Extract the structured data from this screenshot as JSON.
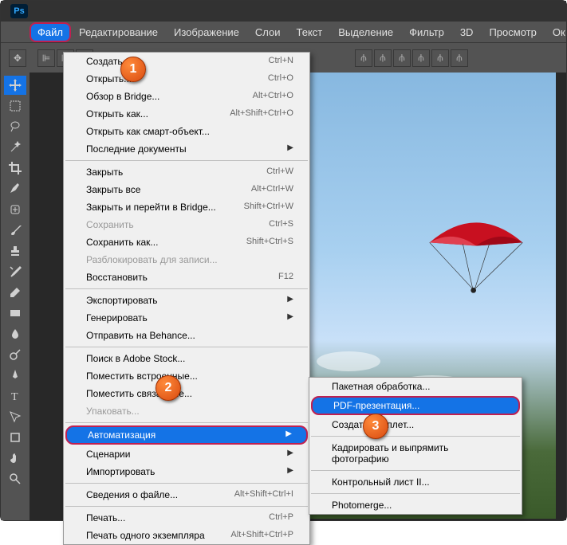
{
  "logo": "Ps",
  "menubar": [
    "Файл",
    "Редактирование",
    "Изображение",
    "Слои",
    "Текст",
    "Выделение",
    "Фильтр",
    "3D",
    "Просмотр",
    "Ок"
  ],
  "file_menu": {
    "groups": [
      [
        {
          "label": "Создать...",
          "shortcut": "Ctrl+N"
        },
        {
          "label": "Открыть...",
          "shortcut": "Ctrl+O"
        },
        {
          "label": "Обзор в Bridge...",
          "shortcut": "Alt+Ctrl+O"
        },
        {
          "label": "Открыть как...",
          "shortcut": "Alt+Shift+Ctrl+O"
        },
        {
          "label": "Открыть как смарт-объект..."
        },
        {
          "label": "Последние документы",
          "arrow": true
        }
      ],
      [
        {
          "label": "Закрыть",
          "shortcut": "Ctrl+W"
        },
        {
          "label": "Закрыть все",
          "shortcut": "Alt+Ctrl+W"
        },
        {
          "label": "Закрыть и перейти в Bridge...",
          "shortcut": "Shift+Ctrl+W"
        },
        {
          "label": "Сохранить",
          "shortcut": "Ctrl+S",
          "disabled": true
        },
        {
          "label": "Сохранить как...",
          "shortcut": "Shift+Ctrl+S"
        },
        {
          "label": "Разблокировать для записи...",
          "disabled": true
        },
        {
          "label": "Восстановить",
          "shortcut": "F12"
        }
      ],
      [
        {
          "label": "Экспортировать",
          "arrow": true
        },
        {
          "label": "Генерировать",
          "arrow": true
        },
        {
          "label": "Отправить на Behance..."
        }
      ],
      [
        {
          "label": "Поиск в Adobe Stock..."
        },
        {
          "label": "Поместить встроенные..."
        },
        {
          "label": "Поместить связанные..."
        },
        {
          "label": "Упаковать...",
          "disabled": true
        }
      ],
      [
        {
          "label": "Автоматизация",
          "arrow": true,
          "highlighted": true
        },
        {
          "label": "Сценарии",
          "arrow": true
        },
        {
          "label": "Импортировать",
          "arrow": true
        }
      ],
      [
        {
          "label": "Сведения о файле...",
          "shortcut": "Alt+Shift+Ctrl+I"
        }
      ],
      [
        {
          "label": "Печать...",
          "shortcut": "Ctrl+P"
        },
        {
          "label": "Печать одного экземпляра",
          "shortcut": "Alt+Shift+Ctrl+P"
        }
      ]
    ]
  },
  "submenu": {
    "groups": [
      [
        {
          "label": "Пакетная обработка..."
        },
        {
          "label": "PDF-презентация...",
          "highlighted": true
        },
        {
          "label": "Создать дроплет..."
        }
      ],
      [
        {
          "label": "Кадрировать и выпрямить фотографию"
        }
      ],
      [
        {
          "label": "Контрольный лист II..."
        }
      ],
      [
        {
          "label": "Photomerge..."
        }
      ]
    ]
  },
  "markers": {
    "1": "1",
    "2": "2",
    "3": "3"
  }
}
